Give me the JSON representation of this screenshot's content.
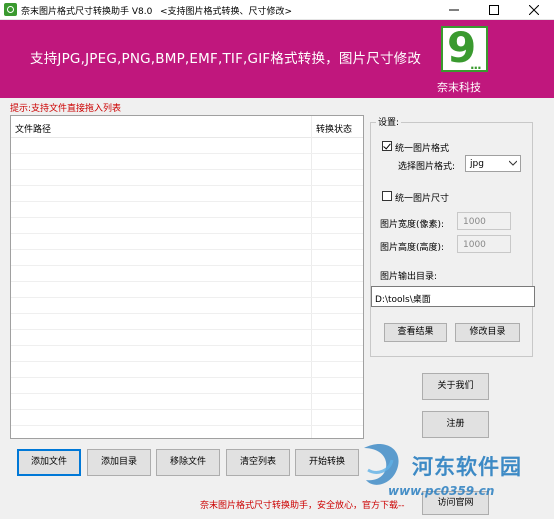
{
  "window": {
    "title": "奈末图片格式尺寸转换助手 V8.0",
    "subtitle": "<支持图片格式转换、尺寸修改>",
    "controls": [
      "minimize",
      "maximize",
      "close"
    ]
  },
  "banner": {
    "headline": "支持JPG,JPEG,PNG,BMP,EMF,TIF,GIF格式转换，图片尺寸修改",
    "logo_number": "9",
    "logo_dots": "...",
    "brand": "奈末科技",
    "bg_color": "#c0177d",
    "logo_color": "#3a9a2f"
  },
  "hint": "提示:支持文件直接拖入列表",
  "file_list": {
    "columns": [
      "文件路径",
      "转换状态"
    ],
    "rows": []
  },
  "settings": {
    "group_label": "设置:",
    "unify_format": {
      "label": "统一图片格式",
      "checked": true
    },
    "format_select": {
      "label": "选择图片格式:",
      "value": "jpg"
    },
    "unify_size": {
      "label": "统一图片尺寸",
      "checked": false
    },
    "width": {
      "label": "图片宽度(像素):",
      "value": "1000"
    },
    "height": {
      "label": "图片高度(高度):",
      "value": "1000"
    },
    "output_dir": {
      "label": "图片输出目录:",
      "value": "D:\\tools\\桌面"
    },
    "view_result": "查看结果",
    "change_dir": "修改目录"
  },
  "side_buttons": {
    "about": "关于我们",
    "register": "注册",
    "visit_site": "访问官网"
  },
  "bottom_buttons": {
    "add_file": "添加文件",
    "add_dir": "添加目录",
    "remove_file": "移除文件",
    "clear_list": "清空列表",
    "start": "开始转换"
  },
  "footer": "奈末图片格式尺寸转换助手，安全放心，官方下载--",
  "watermark": {
    "name": "河东软件园",
    "url": "www.pc0359.cn",
    "color": "#2a7fc1"
  }
}
